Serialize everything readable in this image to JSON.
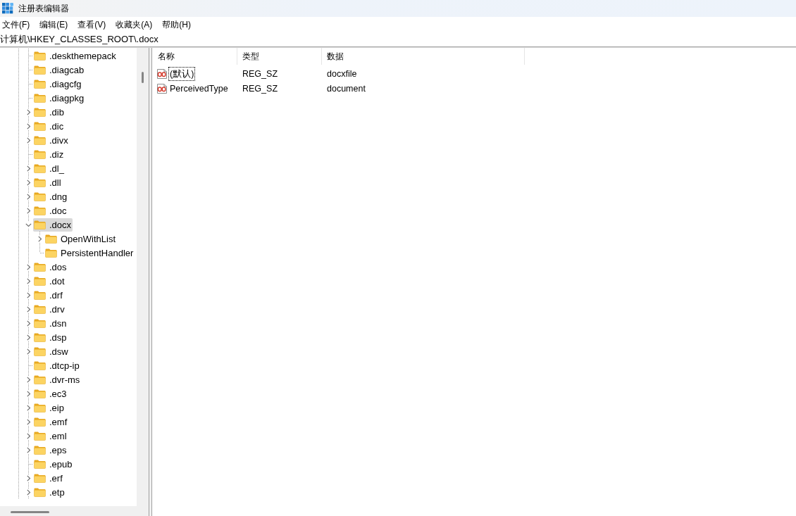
{
  "window": {
    "title": "注册表编辑器"
  },
  "menu": [
    "文件(F)",
    "编辑(E)",
    "查看(V)",
    "收藏夹(A)",
    "帮助(H)"
  ],
  "address_bar": {
    "path": "计算机\\HKEY_CLASSES_ROOT\\.docx"
  },
  "tree": {
    "items": [
      {
        "label": ".deskthemepack",
        "selected": false
      },
      {
        "label": ".diagcab",
        "selected": false
      },
      {
        "label": ".diagcfg",
        "selected": false
      },
      {
        "label": ".diagpkg",
        "selected": false
      },
      {
        "label": ".dib",
        "expanded": false,
        "selected": false
      },
      {
        "label": ".dic",
        "expanded": false,
        "selected": false
      },
      {
        "label": ".divx",
        "expanded": false,
        "selected": false
      },
      {
        "label": ".diz",
        "selected": false
      },
      {
        "label": ".dl_",
        "expanded": false,
        "selected": false
      },
      {
        "label": ".dll",
        "expanded": false,
        "selected": false
      },
      {
        "label": ".dng",
        "expanded": false,
        "selected": false
      },
      {
        "label": ".doc",
        "expanded": false,
        "selected": false
      },
      {
        "label": ".docx",
        "expanded": true,
        "selected": true,
        "children": [
          {
            "label": "OpenWithList",
            "expanded": false,
            "selected": false
          },
          {
            "label": "PersistentHandler",
            "selected": false
          }
        ]
      },
      {
        "label": ".dos",
        "expanded": false,
        "selected": false
      },
      {
        "label": ".dot",
        "expanded": false,
        "selected": false
      },
      {
        "label": ".drf",
        "expanded": false,
        "selected": false
      },
      {
        "label": ".drv",
        "expanded": false,
        "selected": false
      },
      {
        "label": ".dsn",
        "expanded": false,
        "selected": false
      },
      {
        "label": ".dsp",
        "expanded": false,
        "selected": false
      },
      {
        "label": ".dsw",
        "expanded": false,
        "selected": false
      },
      {
        "label": ".dtcp-ip",
        "selected": false
      },
      {
        "label": ".dvr-ms",
        "expanded": false,
        "selected": false
      },
      {
        "label": ".ec3",
        "expanded": false,
        "selected": false
      },
      {
        "label": ".eip",
        "expanded": false,
        "selected": false
      },
      {
        "label": ".emf",
        "expanded": false,
        "selected": false
      },
      {
        "label": ".eml",
        "expanded": false,
        "selected": false
      },
      {
        "label": ".eps",
        "expanded": false,
        "selected": false
      },
      {
        "label": ".epub",
        "selected": false
      },
      {
        "label": ".erf",
        "expanded": false,
        "selected": false
      },
      {
        "label": ".etp",
        "expanded": false,
        "selected": false
      }
    ]
  },
  "values": {
    "columns": [
      "名称",
      "类型",
      "数据"
    ],
    "rows": [
      {
        "name": "(默认)",
        "type": "REG_SZ",
        "data": "docxfile",
        "focused": true
      },
      {
        "name": "PerceivedType",
        "type": "REG_SZ",
        "data": "document",
        "focused": false
      }
    ]
  }
}
